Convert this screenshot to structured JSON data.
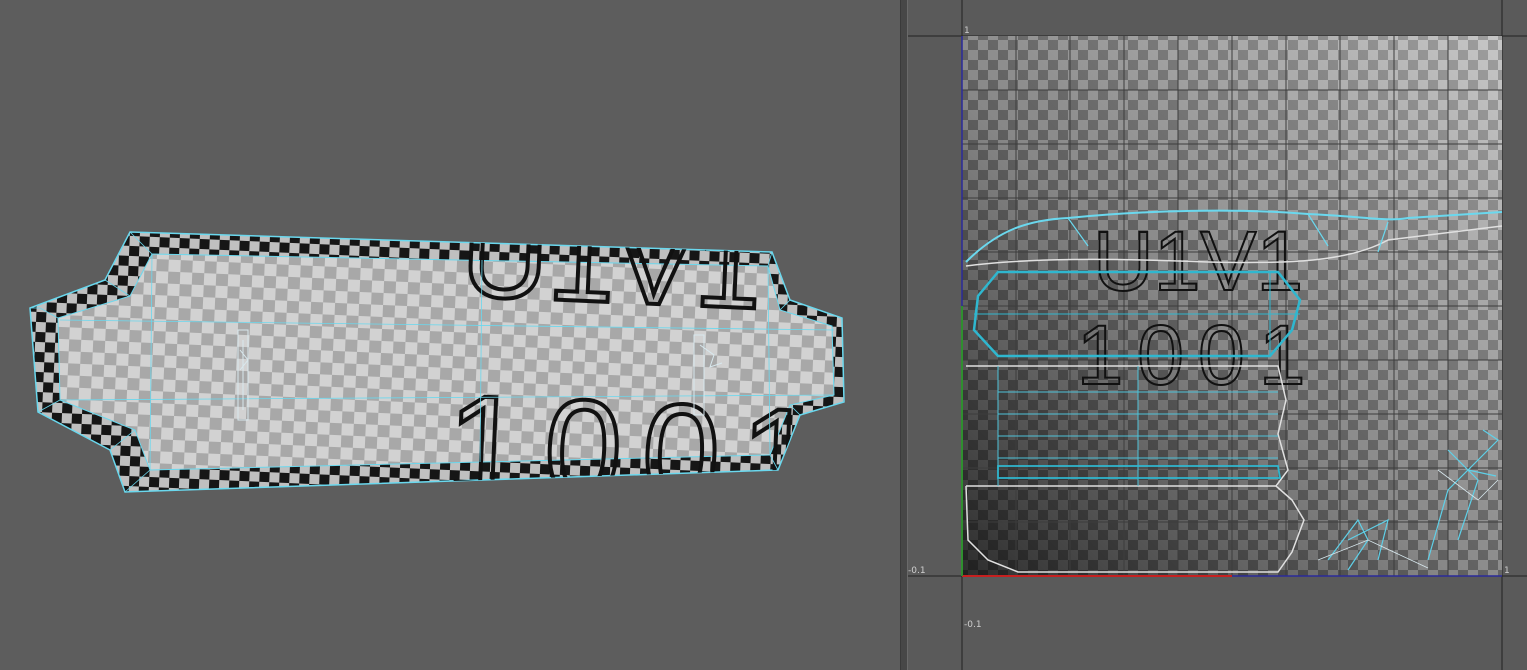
{
  "uv_editor": {
    "tile_label_top": "U1V1",
    "tile_label_bottom": "1001",
    "axis_labels": {
      "left_v": "-0.1",
      "bottom_u": "-0.1",
      "top_v": "1",
      "right_u": "1"
    }
  },
  "viewport": {
    "texture_label_top": "U1V1",
    "texture_label_bottom": "1001"
  },
  "colors": {
    "background": "#5c5c5c",
    "wireframe": "#5fd0e8",
    "checker_dark": "#1a1a1a",
    "checker_light": "#a9a9a9",
    "u_axis": "#c62020",
    "v_axis": "#2f8f2f"
  }
}
